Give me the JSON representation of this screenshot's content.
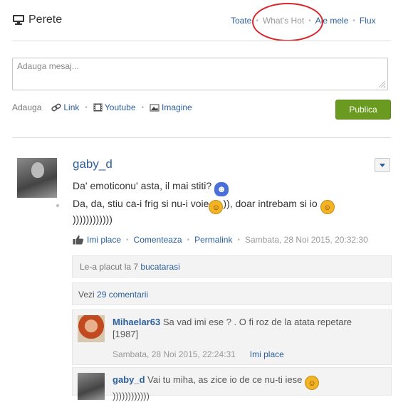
{
  "wall": {
    "title": "Perete",
    "icon": "monitor-icon"
  },
  "filters": [
    {
      "label": "Toate",
      "active": false
    },
    {
      "label": "What's Hot",
      "active": true
    },
    {
      "label": "Ale mele",
      "active": false
    },
    {
      "label": "Flux",
      "active": false
    }
  ],
  "composer": {
    "placeholder": "Adauga mesaj...",
    "attach_label": "Adauga",
    "attachments": [
      {
        "label": "Link",
        "icon": "link-icon"
      },
      {
        "label": "Youtube",
        "icon": "film-icon"
      },
      {
        "label": "Imagine",
        "icon": "image-icon"
      }
    ],
    "publish_label": "Publica",
    "publish_color": "#6a9a1f"
  },
  "post": {
    "user": "gaby_d",
    "line1": "Da' emoticonu' asta, il mai stiti?",
    "line2a": "Da, da, stiu ca-i frig si nu-i voie",
    "line2b": ")), doar intrebam si io",
    "line3": "))))))))))))",
    "actions": {
      "like": "Imi place",
      "comment": "Comenteaza",
      "permalink": "Permalink",
      "date": "Sambata, 28 Noi 2015, 20:32:30"
    },
    "likes_prefix": "Le-a placut la",
    "likes_count": "7",
    "likes_link": "bucatarasi",
    "comments_prefix": "Vezi",
    "comments_link": "29 comentarii"
  },
  "comments": [
    {
      "user": "Mihaelar63",
      "text": "Sa vad imi ese ? . O fi roz de la atata repetare [1987]",
      "date": "Sambata, 28 Noi 2015, 22:24:31",
      "like": "Imi place"
    },
    {
      "user": "gaby_d",
      "text": "Vai tu miha, as zice io de ce nu-ti iese",
      "text2": "))))))))))))"
    }
  ],
  "colors": {
    "link": "#2d5f9a",
    "annotation_circle": "#d9262b"
  }
}
